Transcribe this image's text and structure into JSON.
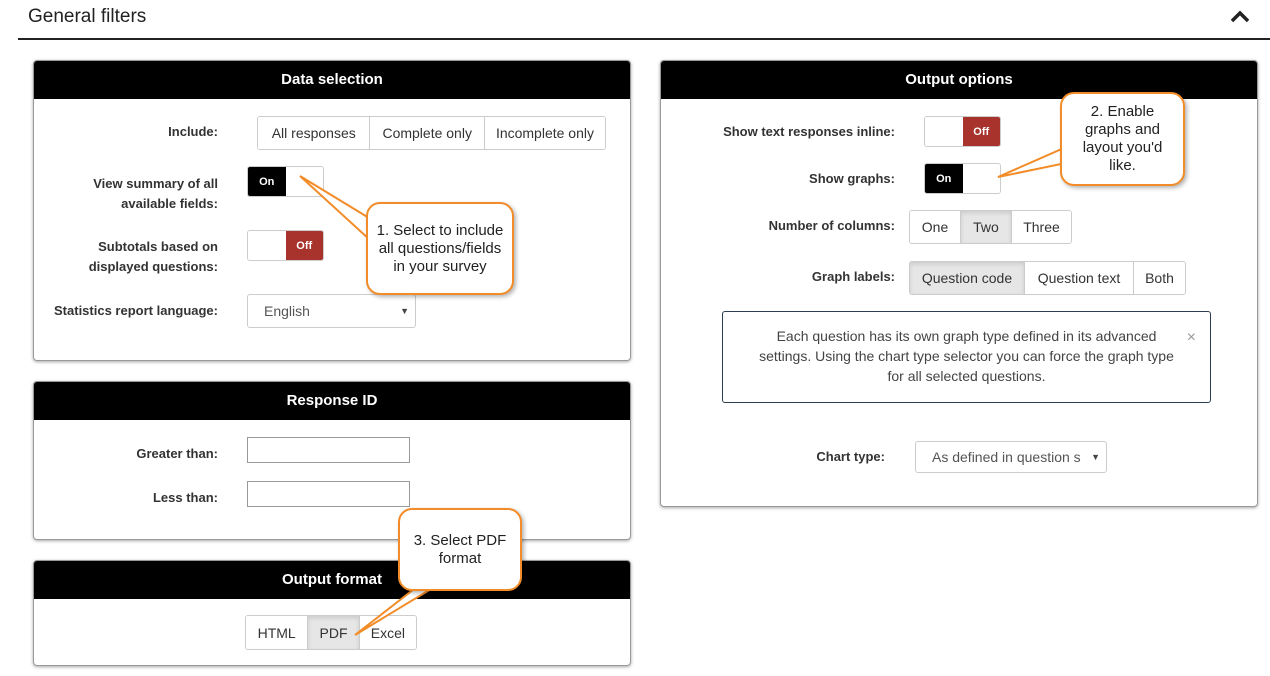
{
  "section": {
    "title": "General filters",
    "collapse_icon": "chevron-up-icon"
  },
  "data_selection": {
    "title": "Data selection",
    "include_label": "Include:",
    "include_options": [
      "All responses",
      "Complete only",
      "Incomplete only"
    ],
    "summary_label": "View summary of all available fields:",
    "summary_toggle": "On",
    "subtotals_label": "Subtotals based on displayed questions:",
    "subtotals_toggle": "Off",
    "language_label": "Statistics report language:",
    "language_value": "English"
  },
  "response_id": {
    "title": "Response ID",
    "greater_label": "Greater than:",
    "greater_value": "",
    "less_label": "Less than:",
    "less_value": ""
  },
  "output_format": {
    "title": "Output format",
    "options": [
      "HTML",
      "PDF",
      "Excel"
    ],
    "selected": "PDF"
  },
  "output_options": {
    "title": "Output options",
    "inline_label": "Show text responses inline:",
    "inline_toggle": "Off",
    "graphs_label": "Show graphs:",
    "graphs_toggle": "On",
    "columns_label": "Number of columns:",
    "columns_options": [
      "One",
      "Two",
      "Three"
    ],
    "columns_selected": "Two",
    "graph_labels_label": "Graph labels:",
    "graph_labels_options": [
      "Question code",
      "Question text",
      "Both"
    ],
    "graph_labels_selected": "Question code",
    "info_text": "Each question has its own graph type defined in its advanced settings. Using the chart type selector you can force the graph type for all selected questions.",
    "chart_type_label": "Chart type:",
    "chart_type_value": "As defined in question s"
  },
  "callouts": {
    "one": "1. Select to include all questions/fields in your survey",
    "two": "2. Enable graphs and layout you'd like.",
    "three": "3. Select PDF format"
  },
  "colors": {
    "accent": "#f28c28",
    "header": "#000000",
    "off": "#a8332d"
  }
}
